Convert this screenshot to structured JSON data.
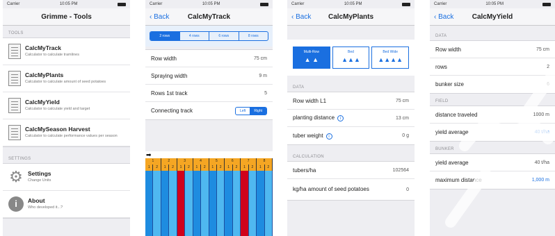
{
  "status": {
    "carrier": "Carrier",
    "time": "10:05 PM"
  },
  "screen1": {
    "title": "Grimme - Tools",
    "tools_header": "TOOLS",
    "tools": [
      {
        "title": "CalcMyTrack",
        "desc": "Calculator to calculate tramlines"
      },
      {
        "title": "CalcMyPlants",
        "desc": "Calculator to calculate amount of seed potatoes"
      },
      {
        "title": "CalcMyYield",
        "desc": "Calculator to calculate yield and target"
      },
      {
        "title": "CalcMySeason Harvest",
        "desc": "Calculator to calculate performance values per season"
      }
    ],
    "settings_header": "SETTINGS",
    "settings": [
      {
        "title": "Settings",
        "desc": "Change Units"
      },
      {
        "title": "About",
        "desc": "Who developed it...?"
      }
    ]
  },
  "screen2": {
    "back": "Back",
    "title": "CalcMyTrack",
    "segments": [
      "2 rows",
      "4 rows",
      "6 rows",
      "8 rows"
    ],
    "rows": [
      {
        "label": "Row width",
        "value": "75 cm"
      },
      {
        "label": "Spraying width",
        "value": "9 m"
      },
      {
        "label": "Rows 1st track",
        "value": "5"
      }
    ],
    "connecting": {
      "label": "Connecting track",
      "left": "Left",
      "right": "Right"
    },
    "arrow": "➡",
    "track_numbers": [
      "1",
      "2",
      "3",
      "4",
      "5",
      "6",
      "7",
      "8"
    ],
    "track_pattern": [
      "1",
      "2",
      "1",
      "2",
      "1",
      "2",
      "1",
      "2",
      "1",
      "2",
      "1",
      "2",
      "1",
      "2",
      "1",
      "2"
    ]
  },
  "screen3": {
    "back": "Back",
    "title": "CalcMyPlants",
    "planting_options": [
      "Multi-Row",
      "Bed",
      "Bed Wide"
    ],
    "data_header": "DATA",
    "rows": [
      {
        "label": "Row width L1",
        "value": "75 cm"
      },
      {
        "label": "planting distance",
        "value": "13 cm"
      },
      {
        "label": "tuber weight",
        "value": "0 g"
      }
    ],
    "calc_header": "CALCULATION",
    "calc": [
      {
        "label": "tubers/ha",
        "value": "102564"
      },
      {
        "label": "kg/ha amount of seed potatoes",
        "value": "0"
      }
    ]
  },
  "screen4": {
    "back": "Back",
    "title": "CalcMyYield",
    "data_header": "DATA",
    "rows": [
      {
        "label": "Row width",
        "value": "75 cm"
      },
      {
        "label": "rows",
        "value": "2"
      },
      {
        "label": "bunker size",
        "value": "6"
      }
    ],
    "field_header": "FIELD",
    "field": [
      {
        "label": "distance traveled",
        "value": "1000 m"
      },
      {
        "label": "yield average",
        "value": "40 t/ha"
      }
    ],
    "bunker_header": "BUNKER",
    "bunker": [
      {
        "label": "yield average",
        "value": "40 t/ha"
      },
      {
        "label": "maximum distance",
        "value": "1,000 m"
      }
    ]
  },
  "colors": {
    "accent": "#1a6fe0",
    "track_orange": "#f5a623",
    "track_red": "#d0021b",
    "track_blue": "#1e8ce0",
    "track_light": "#4fb8f0"
  }
}
